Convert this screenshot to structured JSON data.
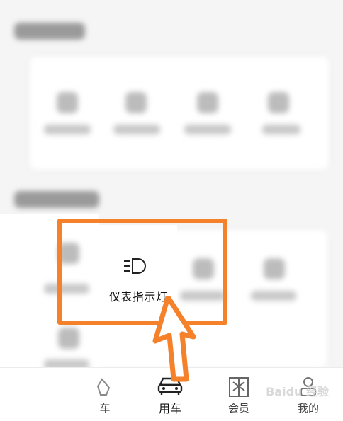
{
  "feature": {
    "label": "仪表指示灯",
    "icon": "dashboard-light-icon"
  },
  "tabbar": {
    "items": [
      {
        "label": "车",
        "icon": "car-alert-icon",
        "active": false
      },
      {
        "label": "用车",
        "icon": "car-front-icon",
        "active": true
      },
      {
        "label": "会员",
        "icon": "gift-box-icon",
        "active": false
      },
      {
        "label": "我的",
        "icon": "profile-icon",
        "active": false
      }
    ]
  },
  "watermark": {
    "text": "Baidu 经验"
  },
  "colors": {
    "highlight": "#f5822a",
    "active_tab": "#111111"
  }
}
